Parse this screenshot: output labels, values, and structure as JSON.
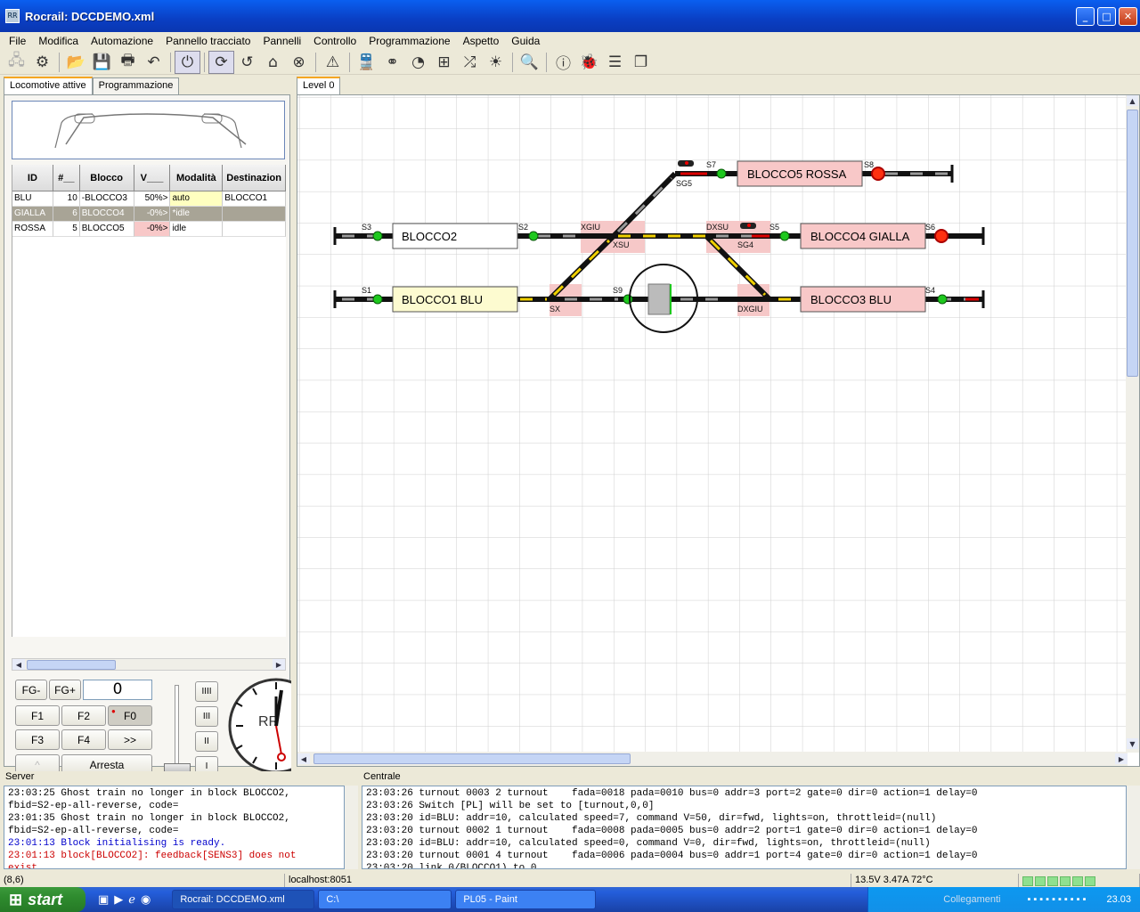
{
  "window": {
    "title": "Rocrail: DCCDEMO.xml",
    "icon_text": "RR"
  },
  "menu": [
    "File",
    "Modifica",
    "Automazione",
    "Pannello tracciato",
    "Pannelli",
    "Controllo",
    "Programmazione",
    "Aspetto",
    "Guida"
  ],
  "left_tabs": {
    "locos": "Locomotive attive",
    "prog": "Programmazione"
  },
  "loco_table": {
    "headers": [
      "ID",
      "#__",
      "Blocco",
      "V___",
      "Modalità",
      "Destinazion"
    ],
    "rows": [
      {
        "id": "BLU",
        "addr": "10",
        "block": "-BLOCCO3",
        "speed": "50%>",
        "mode": "auto",
        "dest": "BLOCCO1"
      },
      {
        "id": "GIALLA",
        "addr": "6",
        "block": "BLOCCO4",
        "speed": "-0%>",
        "mode": "*idle",
        "dest": ""
      },
      {
        "id": "ROSSA",
        "addr": "5",
        "block": "BLOCCO5",
        "speed": "-0%>",
        "mode": "idle",
        "dest": ""
      }
    ]
  },
  "controls": {
    "fg_minus": "FG-",
    "fg_plus": "FG+",
    "speed": "0",
    "f1": "F1",
    "f2": "F2",
    "f0": "F0",
    "f3": "F3",
    "f4": "F4",
    "more": ">>",
    "up": "^",
    "stop": "Arresta",
    "gear4": "IIII",
    "gear3": "III",
    "gear2": "II",
    "gear1": "I",
    "clock_label": "RR"
  },
  "plan": {
    "tab": "Level 0",
    "blocks": {
      "b2": "BLOCCO2",
      "b1": "BLOCCO1 BLU",
      "b5": "BLOCCO5 ROSSA",
      "b4": "BLOCCO4 GIALLA",
      "b3": "BLOCCO3 BLU"
    },
    "labels": {
      "s1": "S1",
      "s2": "S2",
      "s3": "S3",
      "s4": "S4",
      "s5": "S5",
      "s6": "S6",
      "s7": "S7",
      "s8": "S8",
      "s9": "S9",
      "sg5": "SG5",
      "sg4": "SG4",
      "xgiu": "XGIU",
      "xsu": "XSU",
      "dxsu": "DXSU",
      "dxgiu": "DXGIU",
      "sx": "SX"
    }
  },
  "server_log": {
    "label": "Server",
    "lines": [
      {
        "t": "23:03:25 Ghost train no longer in block BLOCCO2,",
        "c": "#000000"
      },
      {
        "t": "fbid=S2-ep-all-reverse, code=",
        "c": "#000000"
      },
      {
        "t": "23:01:35 Ghost train no longer in block BLOCCO2,",
        "c": "#000000"
      },
      {
        "t": "fbid=S2-ep-all-reverse, code=",
        "c": "#000000"
      },
      {
        "t": "23:01:13 Block initialising is ready.",
        "c": "#0000cc"
      },
      {
        "t": "23:01:13 block[BLOCCO2]: feedback[SENS3] does not",
        "c": "#cc0000"
      },
      {
        "t": "exist",
        "c": "#cc0000"
      }
    ]
  },
  "central_log": {
    "label": "Centrale",
    "lines": [
      "23:03:26 turnout 0003 2 turnout    fada=0018 pada=0010 bus=0 addr=3 port=2 gate=0 dir=0 action=1 delay=0",
      "23:03:26 Switch [PL] will be set to [turnout,0,0]",
      "23:03:20 id=BLU: addr=10, calculated speed=7, command V=50, dir=fwd, lights=on, throttleid=(null)",
      "23:03:20 turnout 0002 1 turnout    fada=0008 pada=0005 bus=0 addr=2 port=1 gate=0 dir=0 action=1 delay=0",
      "23:03:20 id=BLU: addr=10, calculated speed=0, command V=0, dir=fwd, lights=on, throttleid=(null)",
      "23:03:20 turnout 0001 4 turnout    fada=0006 pada=0004 bus=0 addr=1 port=4 gate=0 dir=0 action=1 delay=0",
      "23:03:20 link 0/BLOCCO1) to 0"
    ]
  },
  "status": {
    "coords": "(8,6)",
    "host": "localhost:8051",
    "power": "13.5V 3.47A 72°C"
  },
  "taskbar": {
    "start": "start",
    "task1": "Rocrail: DCCDEMO.xml",
    "task2": "C:\\",
    "task3": "PL05 - Paint",
    "links": "Collegamenti",
    "clock": "23.03"
  }
}
